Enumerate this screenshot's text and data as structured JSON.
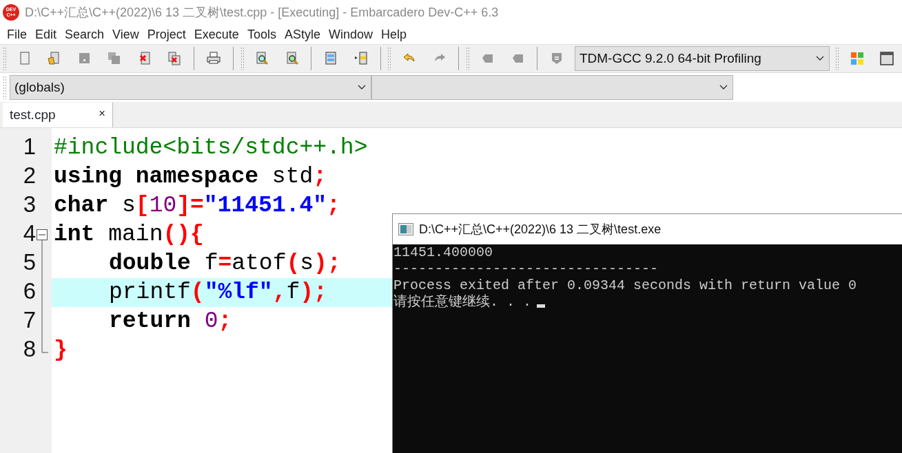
{
  "window": {
    "title": "D:\\C++汇总\\C++(2022)\\6 13 二叉树\\test.cpp - [Executing] - Embarcadero Dev-C++ 6.3",
    "logo": [
      "DEV",
      "C++"
    ]
  },
  "menu": [
    "File",
    "Edit",
    "Search",
    "View",
    "Project",
    "Execute",
    "Tools",
    "AStyle",
    "Window",
    "Help"
  ],
  "compiler_select": {
    "value": "TDM-GCC 9.2.0 64-bit Profiling"
  },
  "scope_select": {
    "value": "(globals)"
  },
  "tabs": [
    {
      "label": "test.cpp",
      "selected": true,
      "close": "×"
    }
  ],
  "editor": {
    "lines": [
      {
        "number": "1",
        "highlighted": false,
        "indented": false,
        "fold_toggle": false,
        "fold_guide": false,
        "tokens": [
          {
            "kind": "preproc",
            "text": "#include<bits/stdc++.h>"
          }
        ]
      },
      {
        "number": "2",
        "highlighted": false,
        "indented": false,
        "fold_toggle": false,
        "fold_guide": false,
        "tokens": [
          {
            "kind": "keyword",
            "text": "using namespace"
          },
          {
            "kind": "plain",
            "text": " std"
          },
          {
            "kind": "symbol",
            "text": ";"
          }
        ]
      },
      {
        "number": "3",
        "highlighted": false,
        "indented": false,
        "fold_toggle": false,
        "fold_guide": false,
        "tokens": [
          {
            "kind": "keyword",
            "text": "char"
          },
          {
            "kind": "plain",
            "text": " s"
          },
          {
            "kind": "symbol",
            "text": "["
          },
          {
            "kind": "number",
            "text": "10"
          },
          {
            "kind": "symbol",
            "text": "]="
          },
          {
            "kind": "string",
            "text": "\"11451.4\""
          },
          {
            "kind": "symbol",
            "text": ";"
          }
        ]
      },
      {
        "number": "4",
        "highlighted": false,
        "indented": false,
        "fold_toggle": true,
        "fold_guide": false,
        "tokens": [
          {
            "kind": "keyword",
            "text": "int"
          },
          {
            "kind": "plain",
            "text": " main"
          },
          {
            "kind": "symbol",
            "text": "(){"
          }
        ]
      },
      {
        "number": "5",
        "highlighted": false,
        "indented": true,
        "fold_toggle": false,
        "fold_guide": true,
        "tokens": [
          {
            "kind": "keyword",
            "text": "double"
          },
          {
            "kind": "plain",
            "text": " f"
          },
          {
            "kind": "symbol",
            "text": "="
          },
          {
            "kind": "plain",
            "text": "atof"
          },
          {
            "kind": "symbol",
            "text": "("
          },
          {
            "kind": "plain",
            "text": "s"
          },
          {
            "kind": "symbol",
            "text": ");"
          }
        ]
      },
      {
        "number": "6",
        "highlighted": true,
        "indented": true,
        "fold_toggle": false,
        "fold_guide": true,
        "tokens": [
          {
            "kind": "plain",
            "text": "printf"
          },
          {
            "kind": "symbol",
            "text": "("
          },
          {
            "kind": "string",
            "text": "\"%lf\""
          },
          {
            "kind": "symbol",
            "text": ","
          },
          {
            "kind": "plain",
            "text": "f"
          },
          {
            "kind": "symbol",
            "text": ");"
          }
        ]
      },
      {
        "number": "7",
        "highlighted": false,
        "indented": true,
        "fold_toggle": false,
        "fold_guide": true,
        "tokens": [
          {
            "kind": "keyword",
            "text": "return"
          },
          {
            "kind": "number",
            "text": " 0"
          },
          {
            "kind": "symbol",
            "text": ";"
          }
        ]
      },
      {
        "number": "8",
        "highlighted": false,
        "indented": false,
        "fold_toggle": false,
        "fold_guide": true,
        "tokens": [
          {
            "kind": "symbol",
            "text": "}"
          }
        ]
      }
    ]
  },
  "console": {
    "title": "D:\\C++汇总\\C++(2022)\\6 13 二叉树\\test.exe",
    "lines": [
      "11451.400000",
      "--------------------------------",
      "Process exited after 0.09344 seconds with return value 0",
      "请按任意键继续. . ."
    ],
    "cursor": true
  }
}
